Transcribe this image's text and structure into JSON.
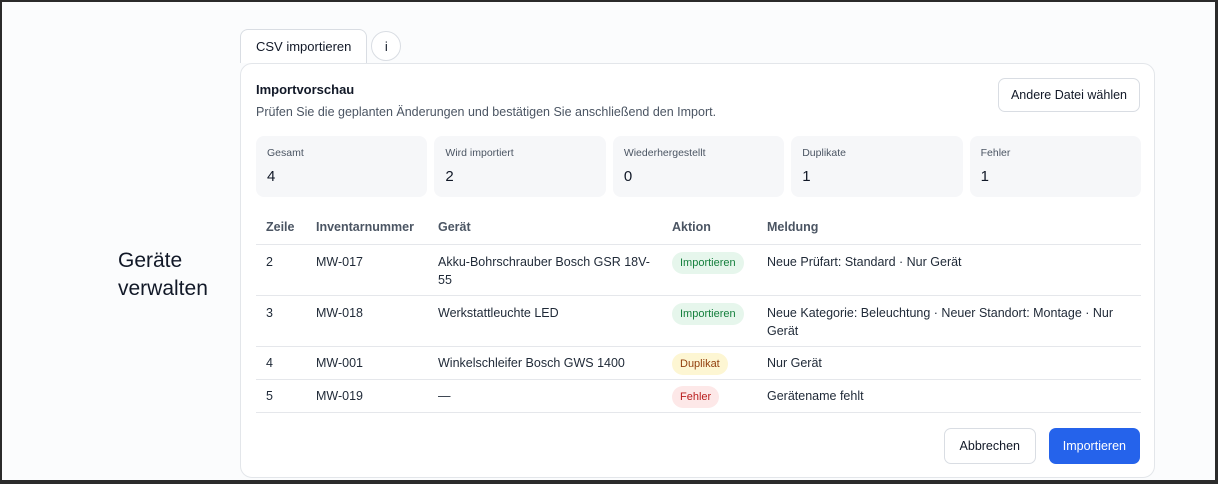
{
  "page": {
    "title": "Geräte verwalten"
  },
  "tabs": {
    "csv_label": "CSV importieren",
    "info_label": "i"
  },
  "card": {
    "title": "Importvorschau",
    "description": "Prüfen Sie die geplanten Änderungen und bestätigen Sie anschließend den Import.",
    "other_file_label": "Andere Datei wählen"
  },
  "stats": [
    {
      "label": "Gesamt",
      "value": "4"
    },
    {
      "label": "Wird importiert",
      "value": "2"
    },
    {
      "label": "Wiederhergestellt",
      "value": "0"
    },
    {
      "label": "Duplikate",
      "value": "1"
    },
    {
      "label": "Fehler",
      "value": "1"
    }
  ],
  "table": {
    "headers": {
      "zeile": "Zeile",
      "inventarnummer": "Inventarnummer",
      "geraet": "Gerät",
      "aktion": "Aktion",
      "meldung": "Meldung"
    },
    "rows": [
      {
        "zeile": "2",
        "inventarnummer": "MW-017",
        "geraet": "Akku-Bohrschrauber Bosch GSR 18V-55",
        "aktion": "Importieren",
        "meldung": "Neue Prüfart: Standard · Nur Gerät"
      },
      {
        "zeile": "3",
        "inventarnummer": "MW-018",
        "geraet": "Werkstattleuchte LED",
        "aktion": "Importieren",
        "meldung": "Neue Kategorie: Beleuchtung · Neuer Standort: Montage · Nur Gerät"
      },
      {
        "zeile": "4",
        "inventarnummer": "MW-001",
        "geraet": "Winkelschleifer Bosch GWS 1400",
        "aktion": "Duplikat",
        "meldung": "Nur Gerät"
      },
      {
        "zeile": "5",
        "inventarnummer": "MW-019",
        "geraet": "—",
        "aktion": "Fehler",
        "meldung": "Gerätename fehlt"
      }
    ]
  },
  "footer": {
    "cancel_label": "Abbrechen",
    "import_label": "Importieren"
  },
  "colors": {
    "primary": "#2563eb",
    "import_badge": "#15803d",
    "duplicate_badge": "#92400e",
    "error_badge": "#b91c1c"
  }
}
